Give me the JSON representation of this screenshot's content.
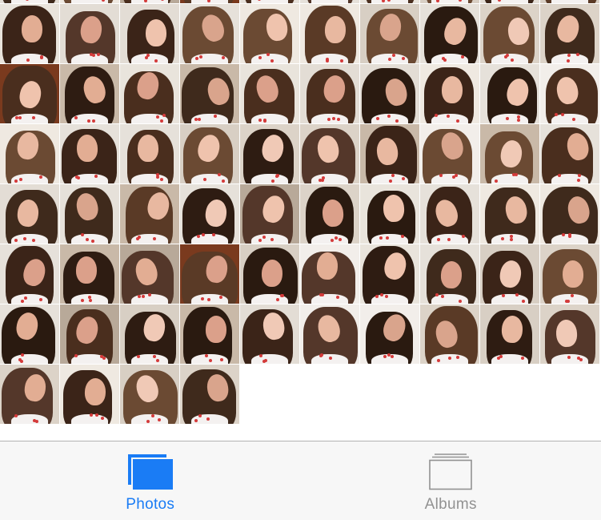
{
  "colors": {
    "tab_active": "#1a7cf5",
    "tab_inactive": "#929292",
    "tabbar_background": "#f7f7f7"
  },
  "grid": {
    "columns": 10,
    "rows": [
      10,
      10,
      10,
      10,
      10,
      10,
      10,
      4
    ],
    "item_type": "selfie-photo"
  },
  "tabbar": {
    "tabs": [
      {
        "id": "photos",
        "label": "Photos",
        "icon": "photos-stack-icon",
        "active": true
      },
      {
        "id": "albums",
        "label": "Albums",
        "icon": "albums-stack-icon",
        "active": false
      }
    ]
  }
}
